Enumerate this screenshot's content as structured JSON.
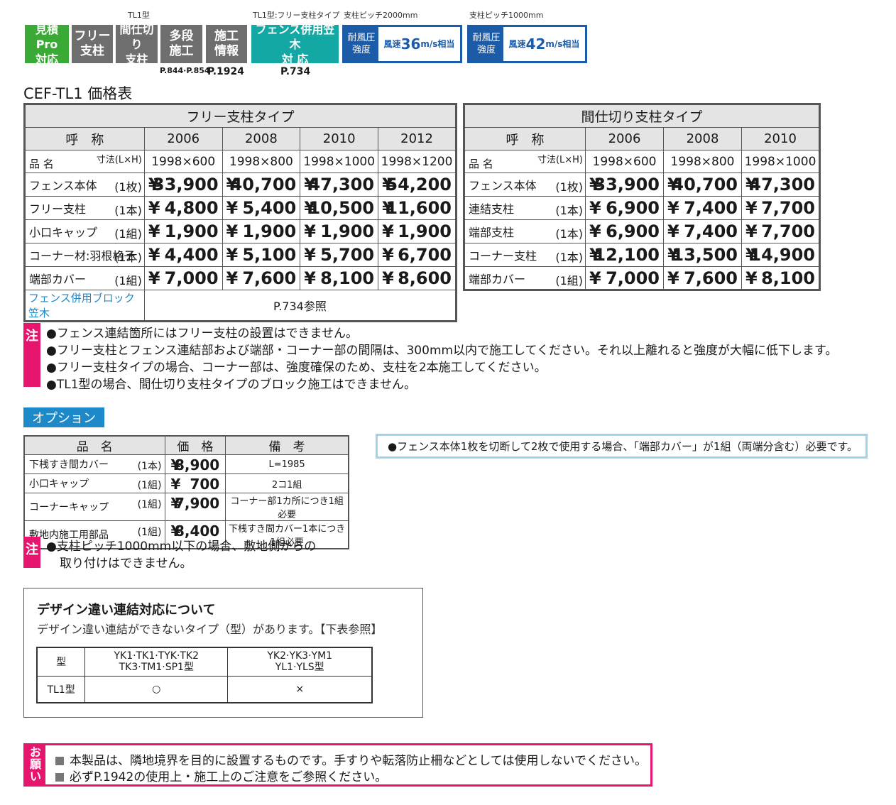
{
  "badges": {
    "top_caption_tl1": "TL1型",
    "top_caption_fence": "TL1型:フリー支柱タイプ",
    "top_caption_pitch2000": "支柱ピッチ2000mm",
    "top_caption_pitch1000": "支柱ピッチ1000mm",
    "estimate": [
      "見積Pro",
      "対応"
    ],
    "free_post": [
      "フリー",
      "支柱"
    ],
    "partition_post": [
      "間仕切り",
      "支柱"
    ],
    "multi_stage": [
      "多段",
      "施工"
    ],
    "construction_info": [
      "施工",
      "情報"
    ],
    "fence_kasagi": [
      "フェンス併用笠木",
      "対 応"
    ],
    "wind1": {
      "label": [
        "耐風圧",
        "強度"
      ],
      "prefix": "風速",
      "value": "36",
      "unit": "m/s相当"
    },
    "wind2": {
      "label": [
        "耐風圧",
        "強度"
      ],
      "prefix": "風速",
      "value": "42",
      "unit": "m/s相当"
    },
    "ref_multi": "P.844·P.854",
    "ref_info": "P.1924",
    "ref_kasagi": "P.734",
    "colors": {
      "green": "#3aa935",
      "gray": "#6e6e6e",
      "teal": "#14a8a4",
      "blue": "#1c5ba8"
    }
  },
  "title": "CEF-TL1 価格表",
  "free_table": {
    "heading": "フリー支柱タイプ",
    "label_name": "呼　称",
    "label_dim": "寸法(L×H)",
    "label_item": "品 名",
    "codes": [
      "2006",
      "2008",
      "2010",
      "2012"
    ],
    "dims": [
      "1998×600",
      "1998×800",
      "1998×1000",
      "1998×1200"
    ],
    "rows": [
      {
        "name": "フェンス本体",
        "unit": "(1枚)",
        "prices": [
          "33,900",
          "40,700",
          "47,300",
          "54,200"
        ]
      },
      {
        "name": "フリー支柱",
        "unit": "(1本)",
        "prices": [
          "4,800",
          "5,400",
          "10,500",
          "11,600"
        ]
      },
      {
        "name": "小口キャップ",
        "unit": "(1組)",
        "prices": [
          "1,900",
          "1,900",
          "1,900",
          "1,900"
        ]
      },
      {
        "name": "コーナー材:羽根格子",
        "unit": "(1本)",
        "prices": [
          "4,400",
          "5,100",
          "5,700",
          "6,700"
        ]
      },
      {
        "name": "端部カバー",
        "unit": "(1組)",
        "prices": [
          "7,000",
          "7,600",
          "8,100",
          "8,600"
        ]
      }
    ],
    "kasagi_label": "フェンス併用ブロック笠木",
    "kasagi_ref": "P.734参照",
    "yen": "¥"
  },
  "partition_table": {
    "heading": "間仕切り支柱タイプ",
    "label_name": "呼　称",
    "label_dim": "寸法(L×H)",
    "label_item": "品 名",
    "codes": [
      "2006",
      "2008",
      "2010"
    ],
    "dims": [
      "1998×600",
      "1998×800",
      "1998×1000"
    ],
    "rows": [
      {
        "name": "フェンス本体",
        "unit": "(1枚)",
        "prices": [
          "33,900",
          "40,700",
          "47,300"
        ]
      },
      {
        "name": "連結支柱",
        "unit": "(1本)",
        "prices": [
          "6,900",
          "7,400",
          "7,700"
        ]
      },
      {
        "name": "端部支柱",
        "unit": "(1本)",
        "prices": [
          "6,900",
          "7,400",
          "7,700"
        ]
      },
      {
        "name": "コーナー支柱",
        "unit": "(1本)",
        "prices": [
          "12,100",
          "13,500",
          "14,900"
        ]
      },
      {
        "name": "端部カバー",
        "unit": "(1組)",
        "prices": [
          "7,000",
          "7,600",
          "8,100"
        ]
      }
    ],
    "yen": "¥"
  },
  "notes": {
    "tag": "注",
    "lines": [
      "●フェンス連結箇所にはフリー支柱の設置はできません。",
      "●フリー支柱とフェンス連結部および端部・コーナー部の間隔は、300mm以内で施工してください。それ以上離れると強度が大幅に低下します。",
      "●フリー支柱タイプの場合、コーナー部は、強度確保のため、支柱を2本施工してください。",
      "●TL1型の場合、間仕切り支柱タイプのブロック施工はできません。"
    ]
  },
  "options": {
    "title": "オプション",
    "headers": [
      "品　名",
      "価　格",
      "備　考"
    ],
    "rows": [
      {
        "name": "下桟すき間カバー",
        "unit": "(1本)",
        "price": "8,900",
        "remark": "L=1985"
      },
      {
        "name": "小口キャップ",
        "unit": "(1組)",
        "price": "700",
        "remark": "2コ1組"
      },
      {
        "name": "コーナーキャップ",
        "unit": "(1組)",
        "price": "7,900",
        "remark": "コーナー部1カ所につき1組必要"
      },
      {
        "name": "敷地内施工用部品",
        "unit": "(1組)",
        "price": "8,400",
        "remark": "下桟すき間カバー1本につき1組必要"
      }
    ],
    "yen": "¥",
    "note_tag": "注",
    "note_lines": [
      "●支柱ピッチ1000mm以下の場合、敷地側からの",
      "取り付けはできません。"
    ]
  },
  "info": "●フェンス本体1枚を切断して2枚で使用する場合、「端部カバー」が1組（両端分含む）必要です。",
  "design": {
    "title": "デザイン違い連結対応について",
    "subtitle": "デザイン違い連結ができないタイプ（型）があります。【下表参照】",
    "col_type": "型",
    "group1": [
      "YK1·TK1·TYK·TK2",
      "TK3·TM1·SP1型"
    ],
    "group2": [
      "YK2·YK3·YM1",
      "YL1·YLS型"
    ],
    "row_label": "TL1型",
    "ok": "○",
    "ng": "×"
  },
  "request": {
    "tag": [
      "お",
      "願",
      "い"
    ],
    "lines": [
      "本製品は、隣地境界を目的に設置するものです。手すりや転落防止柵などとしては使用しないでください。",
      "必ずP.1942の使用上・施工上のご注意をご参照ください。"
    ]
  }
}
